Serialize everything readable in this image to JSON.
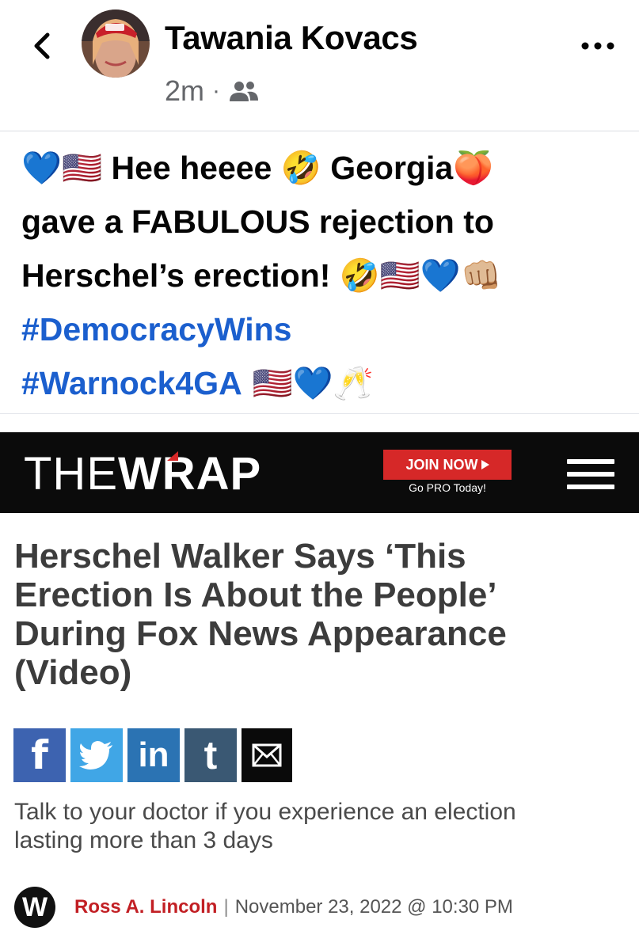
{
  "post": {
    "author_name": "Tawania Kovacs",
    "time_ago": "2m",
    "separator": "·",
    "audience_icon": "friends-icon",
    "back_icon": "chevron-left-icon",
    "more_icon": "more-horizontal-icon",
    "text_lines": [
      {
        "e1": "💙🇺🇸",
        "t1": " Hee heeee ",
        "e2": "🤣",
        "t2": " Georgia",
        "e3": "🍑"
      },
      {
        "t1": "gave a FABULOUS rejection to"
      },
      {
        "t1": "Herschel’s erection! ",
        "e1": "🤣🇺🇸💙👊🏼"
      }
    ],
    "hashtags": [
      "#DemocracyWins",
      "#Warnock4GA"
    ],
    "hashtag_emoji": " 🇺🇸💙🥂"
  },
  "article": {
    "site_logo_the": "THE",
    "site_logo_wrap": "WRAP",
    "join_label": "JOIN NOW",
    "gopro_label": "Go PRO Today!",
    "menu_icon": "hamburger-menu-icon",
    "headline_lines": [
      "Herschel Walker Says ‘This",
      "Erection Is About the People’",
      "During Fox News Appearance",
      "(Video)"
    ],
    "share_buttons": [
      {
        "label": "f",
        "icon": "facebook-icon"
      },
      {
        "label": "",
        "icon": "twitter-icon"
      },
      {
        "label": "in",
        "icon": "linkedin-icon"
      },
      {
        "label": "t",
        "icon": "tumblr-icon"
      },
      {
        "label": "",
        "icon": "email-icon"
      }
    ],
    "dek_lines": [
      "Talk to your doctor if you experience an election",
      "lasting more than 3 days"
    ],
    "byline_logo": "W",
    "author": "Ross A. Lincoln",
    "pipe": "|",
    "date": "November 23, 2022 @ 10:30 PM"
  },
  "colors": {
    "hashtag": "#1b5fce",
    "wrap_red": "#d62828",
    "byline_red": "#c21f24"
  }
}
